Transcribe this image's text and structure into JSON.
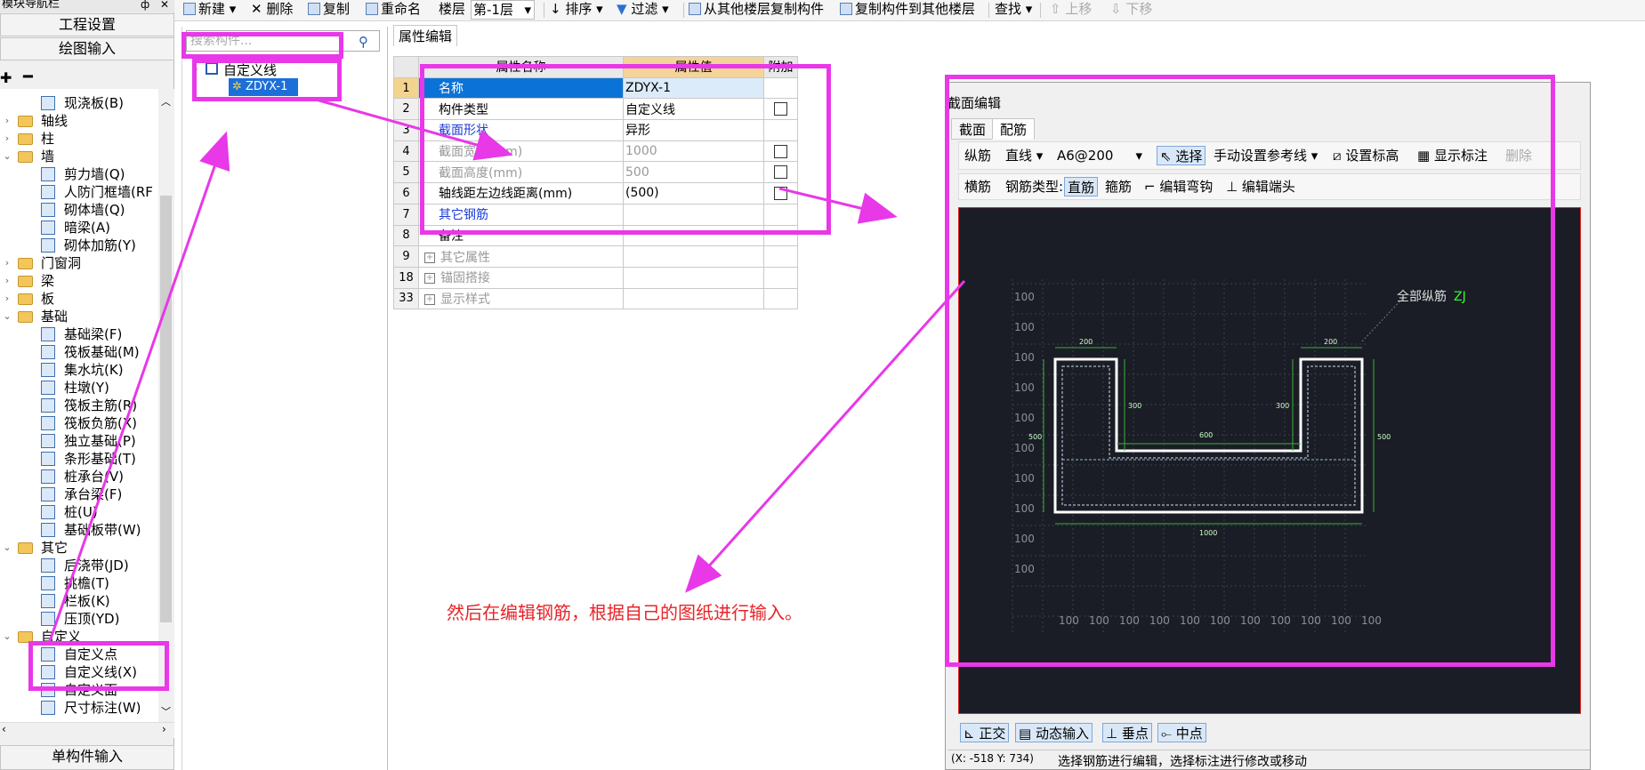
{
  "left_panel": {
    "header": "模块导航栏",
    "pin": "ф",
    "close": "✕",
    "btn_project": "工程设置",
    "btn_drawing": "绘图输入",
    "btn_single": "单构件输入",
    "tree": [
      {
        "label": "现浇板(B)",
        "level": 2,
        "icon": "slab-icon"
      },
      {
        "label": "轴线",
        "level": 1,
        "folder": true,
        "toggle": "›"
      },
      {
        "label": "柱",
        "level": 1,
        "folder": true,
        "toggle": "›"
      },
      {
        "label": "墙",
        "level": 1,
        "folder": true,
        "toggle": "⌄"
      },
      {
        "label": "剪力墙(Q)",
        "level": 2,
        "icon": "shear-wall-icon"
      },
      {
        "label": "人防门框墙(RF",
        "level": 2,
        "icon": "door-frame-wall-icon"
      },
      {
        "label": "砌体墙(Q)",
        "level": 2,
        "icon": "masonry-wall-icon"
      },
      {
        "label": "暗梁(A)",
        "level": 2,
        "icon": "hidden-beam-icon"
      },
      {
        "label": "砌体加筋(Y)",
        "level": 2,
        "icon": "masonry-rebar-icon"
      },
      {
        "label": "门窗洞",
        "level": 1,
        "folder": true,
        "toggle": "›"
      },
      {
        "label": "梁",
        "level": 1,
        "folder": true,
        "toggle": "›"
      },
      {
        "label": "板",
        "level": 1,
        "folder": true,
        "toggle": "›"
      },
      {
        "label": "基础",
        "level": 1,
        "folder": true,
        "toggle": "⌄"
      },
      {
        "label": "基础梁(F)",
        "level": 2,
        "icon": "foundation-beam-icon"
      },
      {
        "label": "筏板基础(M)",
        "level": 2,
        "icon": "raft-foundation-icon"
      },
      {
        "label": "集水坑(K)",
        "level": 2,
        "icon": "sump-pit-icon"
      },
      {
        "label": "柱墩(Y)",
        "level": 2,
        "icon": "column-pier-icon"
      },
      {
        "label": "筏板主筋(R)",
        "level": 2,
        "icon": "raft-main-rebar-icon"
      },
      {
        "label": "筏板负筋(X)",
        "level": 2,
        "icon": "raft-neg-rebar-icon"
      },
      {
        "label": "独立基础(P)",
        "level": 2,
        "icon": "isolated-foundation-icon"
      },
      {
        "label": "条形基础(T)",
        "level": 2,
        "icon": "strip-foundation-icon"
      },
      {
        "label": "桩承台(V)",
        "level": 2,
        "icon": "pile-cap-icon"
      },
      {
        "label": "承台梁(F)",
        "level": 2,
        "icon": "cap-beam-icon"
      },
      {
        "label": "桩(U)",
        "level": 2,
        "icon": "pile-icon"
      },
      {
        "label": "基础板带(W)",
        "level": 2,
        "icon": "foundation-strip-icon"
      },
      {
        "label": "其它",
        "level": 1,
        "folder": true,
        "toggle": "⌄"
      },
      {
        "label": "后浇带(JD)",
        "level": 2,
        "icon": "post-pour-band-icon"
      },
      {
        "label": "挑檐(T)",
        "level": 2,
        "icon": "cornice-icon"
      },
      {
        "label": "栏板(K)",
        "level": 2,
        "icon": "parapet-icon"
      },
      {
        "label": "压顶(YD)",
        "level": 2,
        "icon": "coping-icon"
      },
      {
        "label": "自定义",
        "level": 1,
        "folder": true,
        "toggle": "⌄"
      },
      {
        "label": "自定义点",
        "level": 2,
        "icon": "custom-point-icon"
      },
      {
        "label": "自定义线(X)",
        "level": 2,
        "icon": "custom-line-icon"
      },
      {
        "label": "自定义面",
        "level": 2,
        "icon": "custom-area-icon"
      },
      {
        "label": "尺寸标注(W)",
        "level": 2,
        "icon": "dimension-icon"
      }
    ]
  },
  "toolbar": {
    "new": "新建",
    "delete": "删除",
    "copy": "复制",
    "rename": "重命名",
    "floor_label": "楼层",
    "floor_value": "第-1层",
    "sort": "排序",
    "filter": "过滤",
    "copy_from": "从其他楼层复制构件",
    "copy_to": "复制构件到其他楼层",
    "find": "查找",
    "move_up": "上移",
    "move_down": "下移"
  },
  "component_panel": {
    "search_placeholder": "搜索构件...",
    "root": "自定义线",
    "child": "ZDYX-1"
  },
  "properties": {
    "tab": "属性编辑",
    "headers": {
      "name": "属性名称",
      "value": "属性值",
      "extra": "附加"
    },
    "rows": [
      {
        "num": "1",
        "name": "名称",
        "value": "ZDYX-1",
        "checkbox": false,
        "style": "selected"
      },
      {
        "num": "2",
        "name": "构件类型",
        "value": "自定义线",
        "checkbox": true,
        "style": ""
      },
      {
        "num": "3",
        "name": "截面形状",
        "value": "异形",
        "checkbox": false,
        "style": "blue"
      },
      {
        "num": "4",
        "name": "截面宽度(mm)",
        "value": "1000",
        "checkbox": true,
        "style": "gray"
      },
      {
        "num": "5",
        "name": "截面高度(mm)",
        "value": "500",
        "checkbox": true,
        "style": "gray"
      },
      {
        "num": "6",
        "name": "轴线距左边线距离(mm)",
        "value": "(500)",
        "checkbox": true,
        "style": ""
      },
      {
        "num": "7",
        "name": "其它钢筋",
        "value": "",
        "checkbox": false,
        "style": "blue"
      },
      {
        "num": "8",
        "name": "备注",
        "value": "",
        "checkbox": false,
        "style": ""
      },
      {
        "num": "9",
        "name": "其它属性",
        "value": "",
        "checkbox": false,
        "style": "gray",
        "expand": true
      },
      {
        "num": "18",
        "name": "锚固搭接",
        "value": "",
        "checkbox": false,
        "style": "gray",
        "expand": true
      },
      {
        "num": "33",
        "name": "显示样式",
        "value": "",
        "checkbox": false,
        "style": "gray",
        "expand": true
      }
    ]
  },
  "section_editor": {
    "title": "截面编辑",
    "tab_section": "截面",
    "tab_rebar": "配筋",
    "row1": {
      "longitudinal": "纵筋",
      "line_type": "直线",
      "rebar_spec": "A6@200",
      "select": "选择",
      "manual_ref": "手动设置参考线",
      "set_elevation": "设置标高",
      "show_dims": "显示标注",
      "delete": "删除"
    },
    "row2": {
      "transverse": "横筋",
      "rebar_type_label": "钢筋类型:",
      "straight": "直筋",
      "stirrup": "箍筋",
      "edit_hook": "编辑弯钩",
      "edit_end": "编辑端头"
    },
    "canvas": {
      "all_longitudinal": "全部纵筋",
      "leader_suffix": "ZJ",
      "grid_label": "100",
      "dims": {
        "top_left": "200",
        "top_right": "200",
        "inner_left": "300",
        "inner_right": "300",
        "inner_bottom": "600",
        "left_height": "500",
        "right_height": "500",
        "bottom_width": "1000"
      }
    },
    "bottom": {
      "ortho": "正交",
      "dynamic_input": "动态输入",
      "perpendicular": "垂点",
      "midpoint": "中点"
    },
    "status_coords": "(X: -518 Y: 734)",
    "status_msg": "选择钢筋进行编辑，选择标注进行修改或移动"
  },
  "annotation": {
    "note": "然后在编辑钢筋，根据自己的图纸进行输入。"
  },
  "colors": {
    "highlight": "#e838e8",
    "note": "#e8242a",
    "canvas": "#1a1d25",
    "dim": "#39b03a"
  }
}
